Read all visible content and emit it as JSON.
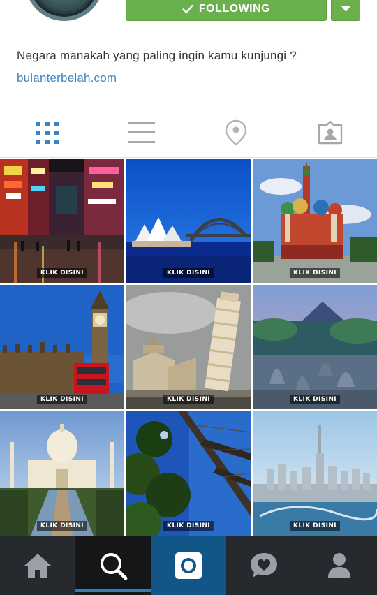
{
  "profile": {
    "follow_label": "FOLLOWING",
    "bio": "Negara manakah yang paling ingin kamu kunjungi ?",
    "website": "bulanterbelah.com"
  },
  "tabs": [
    {
      "icon": "grid-icon",
      "active": true
    },
    {
      "icon": "list-icon",
      "active": false
    },
    {
      "icon": "location-pin-icon",
      "active": false
    },
    {
      "icon": "tagged-photos-icon",
      "active": false
    }
  ],
  "posts": [
    {
      "subject": "city-neon-street",
      "caption": "KLIK DISINI"
    },
    {
      "subject": "sydney-opera-house",
      "caption": "KLIK DISINI"
    },
    {
      "subject": "st-basils-cathedral",
      "caption": "KLIK DISINI"
    },
    {
      "subject": "big-ben-london",
      "caption": "KLIK DISINI"
    },
    {
      "subject": "leaning-tower-of-pisa",
      "caption": "KLIK DISINI"
    },
    {
      "subject": "borobudur-temple",
      "caption": "KLIK DISINI"
    },
    {
      "subject": "taj-mahal",
      "caption": "KLIK DISINI"
    },
    {
      "subject": "eiffel-tower",
      "caption": "KLIK DISINI"
    },
    {
      "subject": "dubai-skyline",
      "caption": "KLIK DISINI"
    }
  ],
  "bottom_nav": [
    {
      "icon": "home-icon",
      "active": false
    },
    {
      "icon": "search-icon",
      "active": true
    },
    {
      "icon": "camera-icon",
      "active": false
    },
    {
      "icon": "activity-heart-icon",
      "active": false
    },
    {
      "icon": "profile-icon",
      "active": false
    }
  ],
  "colors": {
    "follow_green": "#6ab04c",
    "link_blue": "#3b86c4",
    "active_tab_blue": "#3d82c4",
    "nav_bg": "#262a2e",
    "camera_blue": "#125688"
  }
}
